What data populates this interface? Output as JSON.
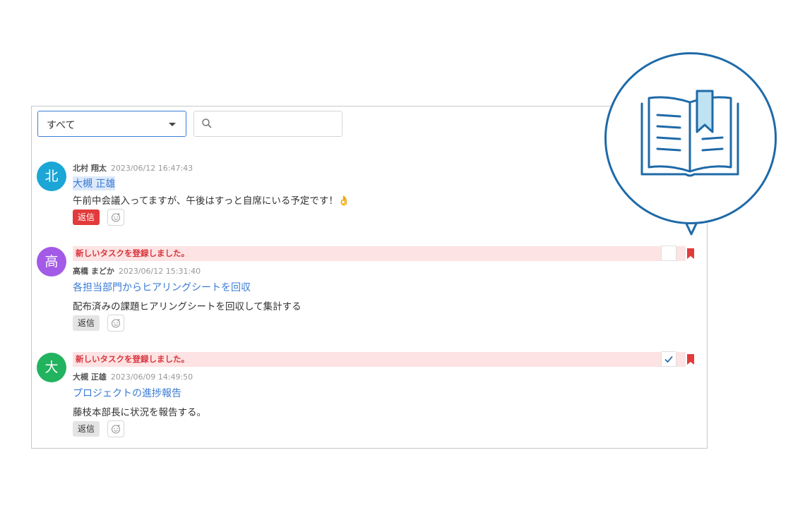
{
  "filter": {
    "selected": "すべて"
  },
  "search": {
    "placeholder": ""
  },
  "messages": [
    {
      "avatar_char": "北",
      "avatar_color": "#1ba6d6",
      "author": "北村 翔太",
      "timestamp": "2023/06/12 16:47:43",
      "title": "大槻 正雄",
      "body": "午前中会議入ってますが、午後はすっと自席にいる予定です！👌",
      "reply_label": "返信",
      "reply_style": "red"
    },
    {
      "notice": "新しいタスクを登録しました。",
      "avatar_char": "高",
      "avatar_color": "#a35ae6",
      "author": "高橋 まどか",
      "timestamp": "2023/06/12 15:31:40",
      "title": "各担当部門からヒアリングシートを回収",
      "body": "配布済みの課題ヒアリングシートを回収して集計する",
      "reply_label": "返信",
      "checked": false
    },
    {
      "notice": "新しいタスクを登録しました。",
      "avatar_char": "大",
      "avatar_color": "#22b35e",
      "author": "大槻 正雄",
      "timestamp": "2023/06/09 14:49:50",
      "title": "プロジェクトの進捗報告",
      "body": "藤枝本部長に状況を報告する。",
      "reply_label": "返信",
      "checked": true
    }
  ],
  "colors": {
    "accent": "#3a7bd5",
    "alert": "#d9363e",
    "bubble_stroke": "#1e6aa8"
  },
  "icons": {
    "bubble": "open-book-icon"
  }
}
